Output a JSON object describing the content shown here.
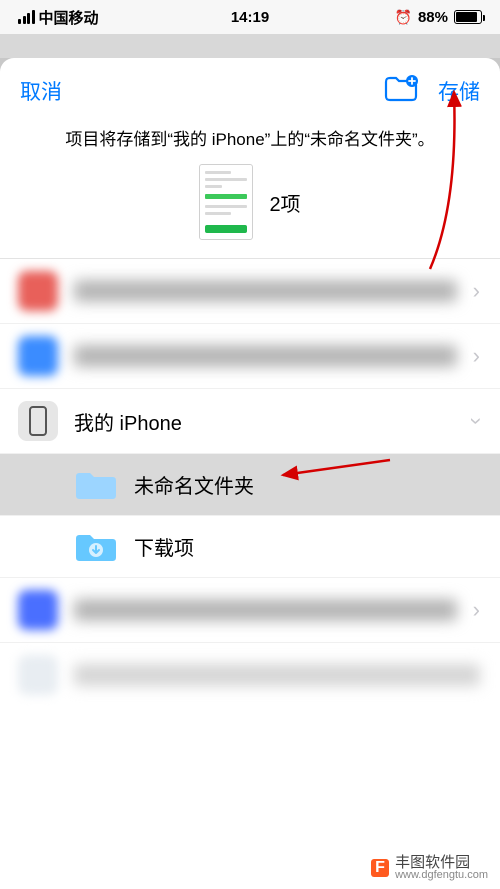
{
  "status": {
    "carrier": "中国移动",
    "time": "14:19",
    "battery_pct": "88%"
  },
  "header": {
    "cancel": "取消",
    "save": "存储"
  },
  "info": {
    "message": "项目将存储到“我的 iPhone”上的“未命名文件夹”。",
    "count_label": "2项"
  },
  "locations": [
    {
      "label": "",
      "chevron": "right",
      "blurred": true,
      "icon_color": "#e8605a"
    },
    {
      "label": "",
      "chevron": "right",
      "blurred": true,
      "icon_color": "#3b8cff"
    },
    {
      "label": "我的 iPhone",
      "chevron": "down",
      "blurred": false,
      "icon": "phone"
    },
    {
      "label": "未命名文件夹",
      "chevron": "",
      "blurred": false,
      "icon": "folder",
      "indent": true,
      "selected": true
    },
    {
      "label": "下载项",
      "chevron": "",
      "blurred": false,
      "icon": "folder-download",
      "indent": true
    },
    {
      "label": "",
      "chevron": "right",
      "blurred": true,
      "icon_color": "#4a6fff"
    },
    {
      "label": "",
      "chevron": "",
      "blurred": true,
      "icon_color": "#bfc8d0"
    }
  ],
  "watermark": {
    "name": "丰图软件园",
    "url": "www.dgfengtu.com"
  }
}
